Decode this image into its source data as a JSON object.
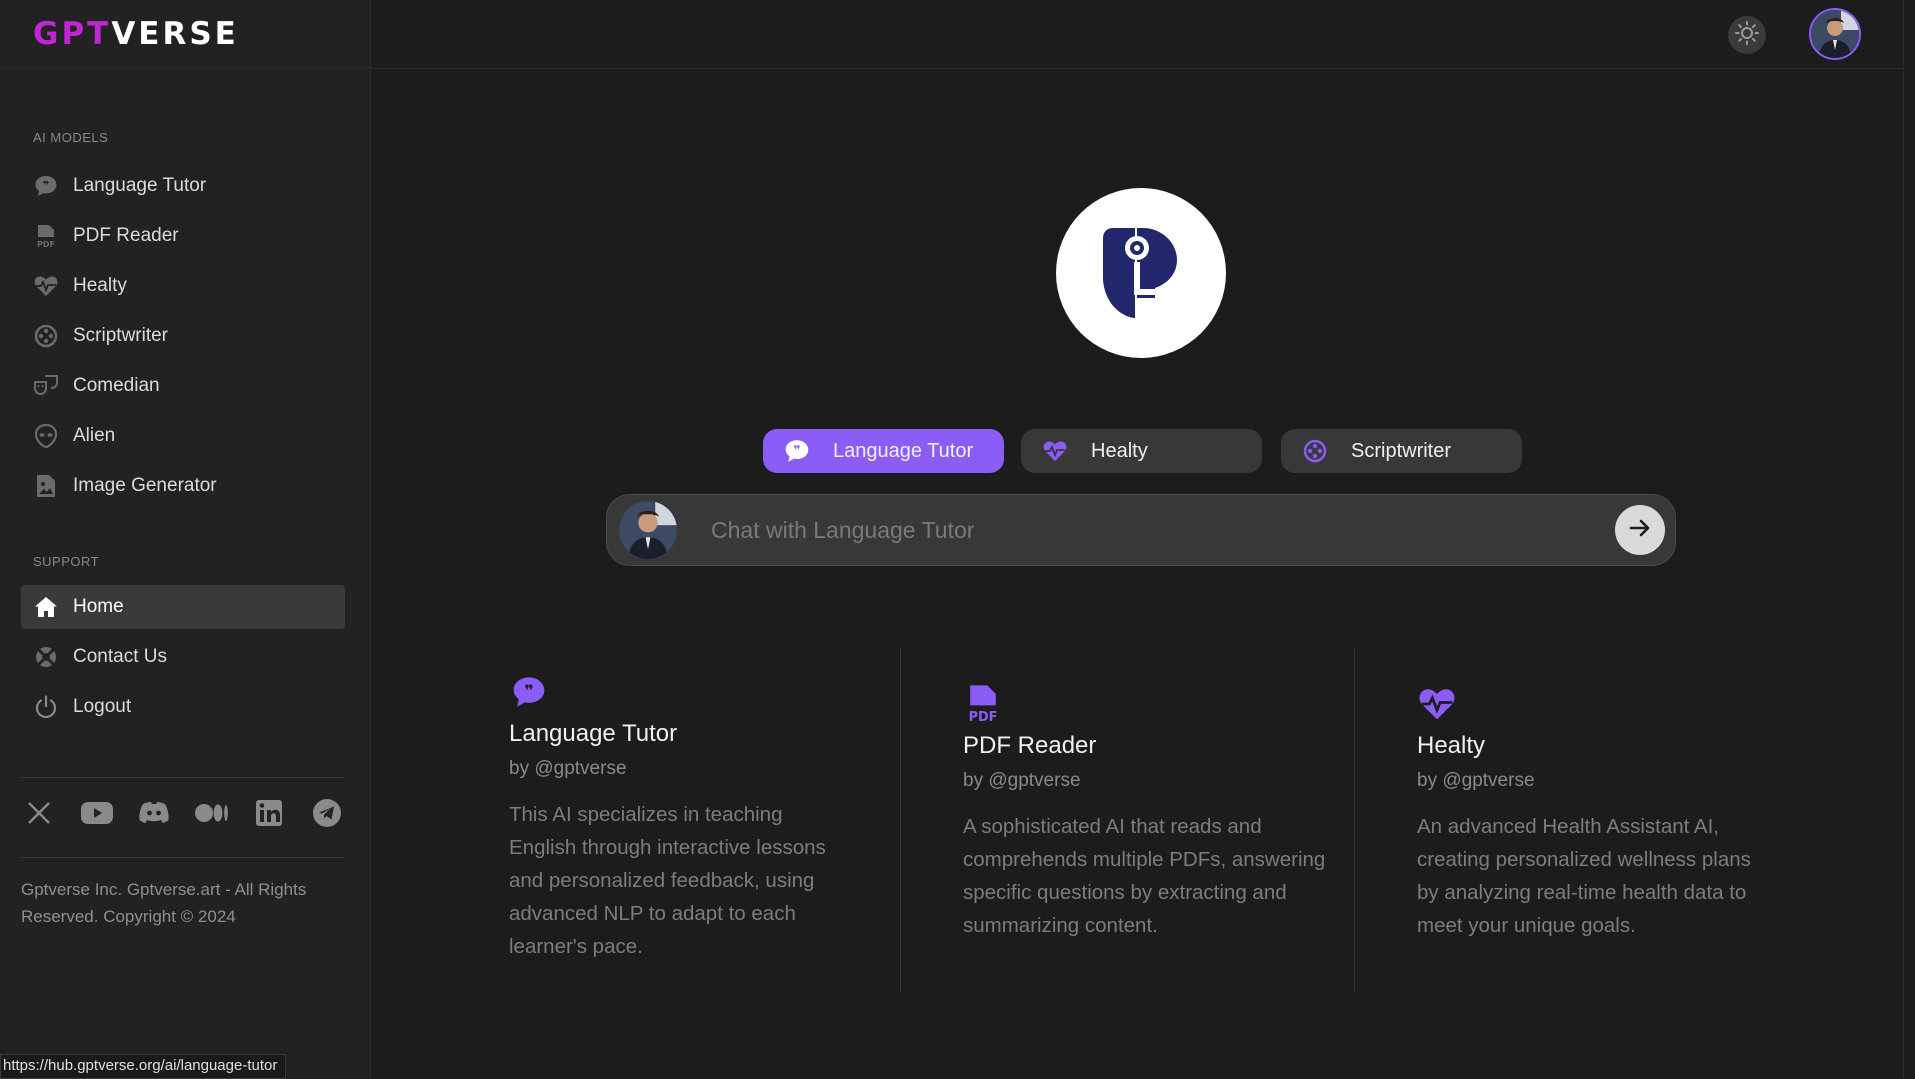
{
  "brand": {
    "part1": "GPT",
    "part2": "VERSE"
  },
  "sidebar": {
    "ai_models_label": "AI MODELS",
    "models": [
      {
        "label": "Language Tutor",
        "icon": "quote-bubble-icon"
      },
      {
        "label": "PDF Reader",
        "icon": "pdf-file-icon"
      },
      {
        "label": "Healty",
        "icon": "heart-pulse-icon"
      },
      {
        "label": "Scriptwriter",
        "icon": "film-reel-icon"
      },
      {
        "label": "Comedian",
        "icon": "theater-masks-icon"
      },
      {
        "label": "Alien",
        "icon": "alien-icon"
      },
      {
        "label": "Image Generator",
        "icon": "image-file-icon"
      }
    ],
    "support_label": "SUPPORT",
    "support": [
      {
        "label": "Home",
        "icon": "home-icon",
        "active": true
      },
      {
        "label": "Contact Us",
        "icon": "support-lifebuoy-icon"
      },
      {
        "label": "Logout",
        "icon": "power-icon"
      }
    ],
    "socials": [
      "x-twitter-icon",
      "youtube-icon",
      "discord-icon",
      "medium-icon",
      "linkedin-icon",
      "telegram-icon"
    ],
    "copyright": "Gptverse Inc. Gptverse.art - All Rights Reserved. Copyright © 2024"
  },
  "pills": [
    {
      "label": "Language Tutor",
      "icon": "quote-bubble-icon",
      "active": true
    },
    {
      "label": "Healty",
      "icon": "heart-pulse-icon",
      "active": false
    },
    {
      "label": "Scriptwriter",
      "icon": "film-reel-icon",
      "active": false
    }
  ],
  "chat": {
    "placeholder": "Chat with Language Tutor"
  },
  "cards": [
    {
      "title": "Language Tutor",
      "by": "by @gptverse",
      "desc": "This AI specializes in teaching English through interactive lessons and personalized feedback, using advanced NLP to adapt to each learner's pace."
    },
    {
      "title": "PDF Reader",
      "by": "by @gptverse",
      "desc": "A sophisticated AI that reads and comprehends multiple PDFs, answering specific questions by extracting and summarizing content."
    },
    {
      "title": "Healty",
      "by": "by @gptverse",
      "desc": "An advanced Health Assistant AI, creating personalized wellness plans by analyzing real-time health data to meet your unique goals."
    }
  ],
  "status_url": "https://hub.gptverse.org/ai/language-tutor",
  "colors": {
    "accent": "#8b5cf6",
    "brand_pink": "#c026d3",
    "background": "#1c1c1c",
    "sidebar": "#222222"
  }
}
